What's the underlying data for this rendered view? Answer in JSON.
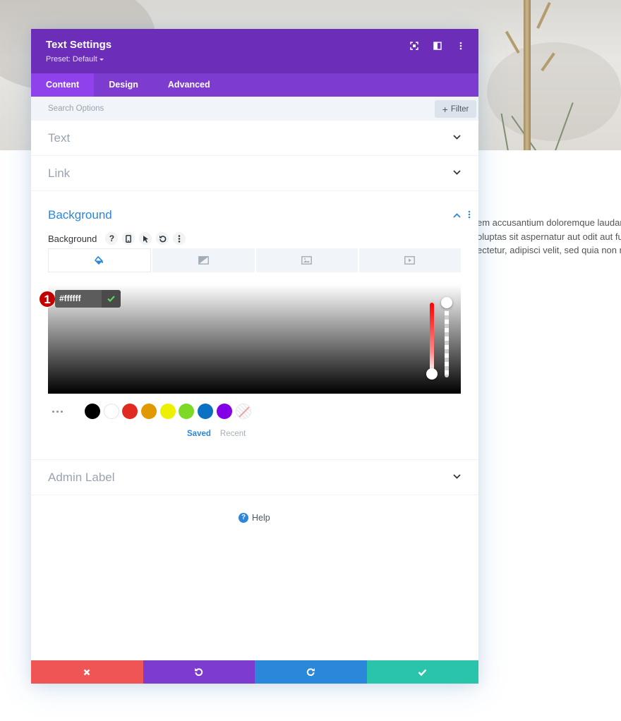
{
  "background_page": {
    "lines": [
      "em accusantium doloremque laudant",
      "oluptas sit aspernatur aut odit aut fug",
      "ectetur, adipisci velit, sed quia non nu"
    ]
  },
  "modal": {
    "title": "Text Settings",
    "preset": "Preset: Default",
    "header_icons": [
      "expand-icon",
      "sidebar-layout-icon",
      "more-vertical-icon"
    ],
    "tabs": [
      {
        "label": "Content",
        "active": true
      },
      {
        "label": "Design",
        "active": false
      },
      {
        "label": "Advanced",
        "active": false
      }
    ],
    "search": {
      "placeholder": "Search Options",
      "filter_label": "Filter"
    },
    "sections": {
      "text": "Text",
      "link": "Link",
      "background": "Background",
      "admin_label": "Admin Label"
    },
    "background": {
      "field_label": "Background",
      "field_icons": [
        "help-icon",
        "mobile-icon",
        "hover-cursor-icon",
        "reset-icon",
        "more-vertical-icon"
      ],
      "type_tabs": [
        "color-fill-icon",
        "gradient-icon",
        "image-icon",
        "video-icon"
      ],
      "active_type": 0,
      "color_value": "#ffffff",
      "step_badge": "1",
      "swatches": [
        "#000000",
        "#ffffff",
        "#e02b20",
        "#e09900",
        "#edf000",
        "#7cda24",
        "#0c71c3",
        "#8300e9"
      ],
      "saved_label": "Saved",
      "recent_label": "Recent"
    },
    "help_label": "Help",
    "footer_buttons": [
      {
        "name": "discard",
        "icon": "close-icon",
        "color": "#ef5555"
      },
      {
        "name": "undo",
        "icon": "undo-icon",
        "color": "#7e3bd0"
      },
      {
        "name": "redo",
        "icon": "redo-icon",
        "color": "#2b87da"
      },
      {
        "name": "save",
        "icon": "check-icon",
        "color": "#29c4a9"
      }
    ]
  },
  "colors": {
    "header": "#6c2eb9",
    "tabs": "#7e3bd0",
    "active_tab": "#8f42ec",
    "accent_blue": "#2b87da"
  }
}
